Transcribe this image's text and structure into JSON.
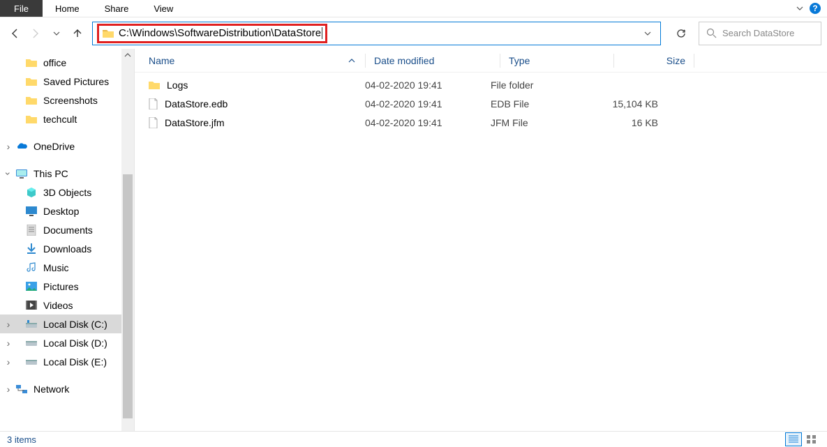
{
  "ribbon": {
    "file": "File",
    "tabs": [
      "Home",
      "Share",
      "View"
    ]
  },
  "address": {
    "path": "C:\\Windows\\SoftwareDistribution\\DataStore"
  },
  "search": {
    "placeholder": "Search DataStore"
  },
  "sidebar": {
    "quick": [
      {
        "label": "office",
        "icon": "folder"
      },
      {
        "label": "Saved Pictures",
        "icon": "folder"
      },
      {
        "label": "Screenshots",
        "icon": "folder"
      },
      {
        "label": "techcult",
        "icon": "folder"
      }
    ],
    "onedrive": {
      "label": "OneDrive"
    },
    "thispc": {
      "label": "This PC"
    },
    "pc": [
      {
        "label": "3D Objects",
        "icon": "3d"
      },
      {
        "label": "Desktop",
        "icon": "desktop"
      },
      {
        "label": "Documents",
        "icon": "documents"
      },
      {
        "label": "Downloads",
        "icon": "downloads"
      },
      {
        "label": "Music",
        "icon": "music"
      },
      {
        "label": "Pictures",
        "icon": "pictures"
      },
      {
        "label": "Videos",
        "icon": "videos"
      },
      {
        "label": "Local Disk (C:)",
        "icon": "drive",
        "selected": true
      },
      {
        "label": "Local Disk (D:)",
        "icon": "drive"
      },
      {
        "label": "Local Disk (E:)",
        "icon": "drive"
      }
    ],
    "network": {
      "label": "Network"
    }
  },
  "columns": {
    "name": "Name",
    "date": "Date modified",
    "type": "Type",
    "size": "Size"
  },
  "items": [
    {
      "name": "Logs",
      "date": "04-02-2020 19:41",
      "type": "File folder",
      "size": "",
      "icon": "folder"
    },
    {
      "name": "DataStore.edb",
      "date": "04-02-2020 19:41",
      "type": "EDB File",
      "size": "15,104 KB",
      "icon": "file"
    },
    {
      "name": "DataStore.jfm",
      "date": "04-02-2020 19:41",
      "type": "JFM File",
      "size": "16 KB",
      "icon": "file"
    }
  ],
  "status": {
    "count": "3 items"
  }
}
